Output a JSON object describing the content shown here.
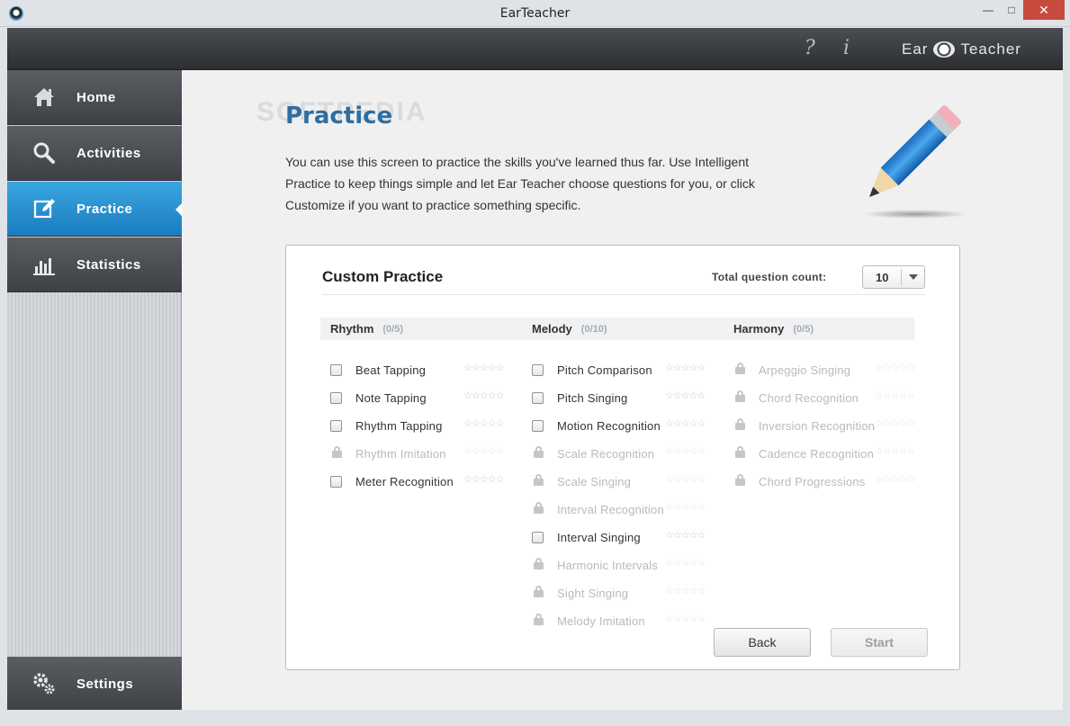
{
  "window": {
    "title": "EarTeacher",
    "min": "—",
    "max": "□",
    "close": "✕"
  },
  "header": {
    "help": "?",
    "info": "i",
    "logo_left": "Ear",
    "logo_right": "Teacher"
  },
  "sidebar": {
    "items": [
      {
        "label": "Home",
        "icon": "home-icon"
      },
      {
        "label": "Activities",
        "icon": "search-icon"
      },
      {
        "label": "Practice",
        "icon": "edit-icon",
        "active": true
      },
      {
        "label": "Statistics",
        "icon": "bar-chart-icon"
      }
    ],
    "settings": {
      "label": "Settings",
      "icon": "gears-icon"
    }
  },
  "main": {
    "watermark": "SOFTPEDIA",
    "title": "Practice",
    "intro": "You can use this screen to practice the skills you've learned thus far.  Use Intelligent Practice to keep things simple and let Ear Teacher choose questions for you, or click Customize if you want to practice something specific."
  },
  "panel": {
    "title": "Custom Practice",
    "question_count_label": "Total question count:",
    "question_count_value": "10",
    "columns": [
      {
        "name": "Rhythm",
        "count": "(0/5)",
        "items": [
          {
            "label": "Beat Tapping",
            "locked": false
          },
          {
            "label": "Note Tapping",
            "locked": false
          },
          {
            "label": "Rhythm Tapping",
            "locked": false
          },
          {
            "label": "Rhythm Imitation",
            "locked": true
          },
          {
            "label": "Meter Recognition",
            "locked": false
          }
        ]
      },
      {
        "name": "Melody",
        "count": "(0/10)",
        "items": [
          {
            "label": "Pitch Comparison",
            "locked": false
          },
          {
            "label": "Pitch Singing",
            "locked": false
          },
          {
            "label": "Motion Recognition",
            "locked": false
          },
          {
            "label": "Scale Recognition",
            "locked": true
          },
          {
            "label": "Scale Singing",
            "locked": true
          },
          {
            "label": "Interval Recognition",
            "locked": true
          },
          {
            "label": "Interval Singing",
            "locked": false
          },
          {
            "label": "Harmonic Intervals",
            "locked": true
          },
          {
            "label": "Sight Singing",
            "locked": true
          },
          {
            "label": "Melody Imitation",
            "locked": true
          }
        ]
      },
      {
        "name": "Harmony",
        "count": "(0/5)",
        "items": [
          {
            "label": "Arpeggio Singing",
            "locked": true
          },
          {
            "label": "Chord Recognition",
            "locked": true
          },
          {
            "label": "Inversion Recognition",
            "locked": true
          },
          {
            "label": "Cadence Recognition",
            "locked": true
          },
          {
            "label": "Chord Progressions",
            "locked": true
          }
        ]
      }
    ],
    "stars": "☆☆☆☆☆",
    "back_label": "Back",
    "start_label": "Start"
  },
  "colors": {
    "accent": "#1a7cc0",
    "title": "#2d6ea3"
  }
}
